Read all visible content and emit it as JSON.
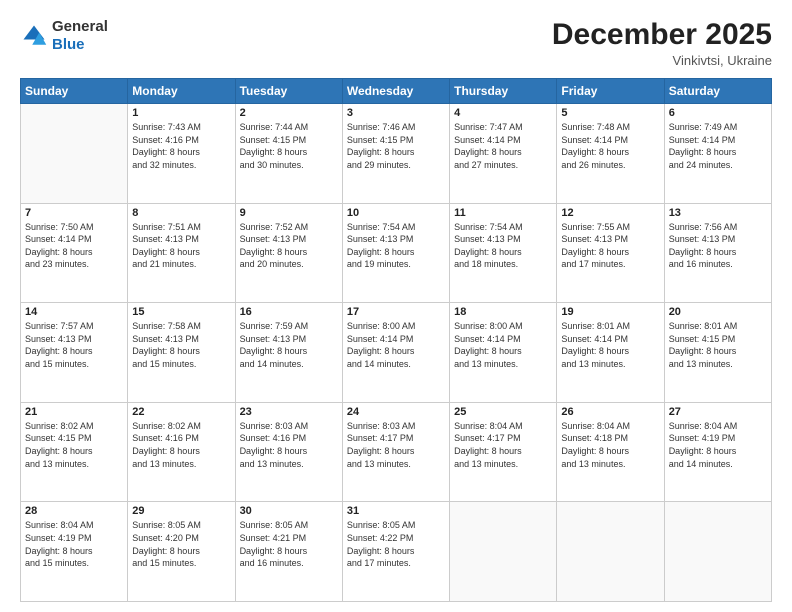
{
  "header": {
    "logo_general": "General",
    "logo_blue": "Blue",
    "month_title": "December 2025",
    "subtitle": "Vinkivtsi, Ukraine"
  },
  "days_of_week": [
    "Sunday",
    "Monday",
    "Tuesday",
    "Wednesday",
    "Thursday",
    "Friday",
    "Saturday"
  ],
  "weeks": [
    [
      {
        "day": "",
        "info": ""
      },
      {
        "day": "1",
        "info": "Sunrise: 7:43 AM\nSunset: 4:16 PM\nDaylight: 8 hours\nand 32 minutes."
      },
      {
        "day": "2",
        "info": "Sunrise: 7:44 AM\nSunset: 4:15 PM\nDaylight: 8 hours\nand 30 minutes."
      },
      {
        "day": "3",
        "info": "Sunrise: 7:46 AM\nSunset: 4:15 PM\nDaylight: 8 hours\nand 29 minutes."
      },
      {
        "day": "4",
        "info": "Sunrise: 7:47 AM\nSunset: 4:14 PM\nDaylight: 8 hours\nand 27 minutes."
      },
      {
        "day": "5",
        "info": "Sunrise: 7:48 AM\nSunset: 4:14 PM\nDaylight: 8 hours\nand 26 minutes."
      },
      {
        "day": "6",
        "info": "Sunrise: 7:49 AM\nSunset: 4:14 PM\nDaylight: 8 hours\nand 24 minutes."
      }
    ],
    [
      {
        "day": "7",
        "info": "Sunrise: 7:50 AM\nSunset: 4:14 PM\nDaylight: 8 hours\nand 23 minutes."
      },
      {
        "day": "8",
        "info": "Sunrise: 7:51 AM\nSunset: 4:13 PM\nDaylight: 8 hours\nand 21 minutes."
      },
      {
        "day": "9",
        "info": "Sunrise: 7:52 AM\nSunset: 4:13 PM\nDaylight: 8 hours\nand 20 minutes."
      },
      {
        "day": "10",
        "info": "Sunrise: 7:54 AM\nSunset: 4:13 PM\nDaylight: 8 hours\nand 19 minutes."
      },
      {
        "day": "11",
        "info": "Sunrise: 7:54 AM\nSunset: 4:13 PM\nDaylight: 8 hours\nand 18 minutes."
      },
      {
        "day": "12",
        "info": "Sunrise: 7:55 AM\nSunset: 4:13 PM\nDaylight: 8 hours\nand 17 minutes."
      },
      {
        "day": "13",
        "info": "Sunrise: 7:56 AM\nSunset: 4:13 PM\nDaylight: 8 hours\nand 16 minutes."
      }
    ],
    [
      {
        "day": "14",
        "info": "Sunrise: 7:57 AM\nSunset: 4:13 PM\nDaylight: 8 hours\nand 15 minutes."
      },
      {
        "day": "15",
        "info": "Sunrise: 7:58 AM\nSunset: 4:13 PM\nDaylight: 8 hours\nand 15 minutes."
      },
      {
        "day": "16",
        "info": "Sunrise: 7:59 AM\nSunset: 4:13 PM\nDaylight: 8 hours\nand 14 minutes."
      },
      {
        "day": "17",
        "info": "Sunrise: 8:00 AM\nSunset: 4:14 PM\nDaylight: 8 hours\nand 14 minutes."
      },
      {
        "day": "18",
        "info": "Sunrise: 8:00 AM\nSunset: 4:14 PM\nDaylight: 8 hours\nand 13 minutes."
      },
      {
        "day": "19",
        "info": "Sunrise: 8:01 AM\nSunset: 4:14 PM\nDaylight: 8 hours\nand 13 minutes."
      },
      {
        "day": "20",
        "info": "Sunrise: 8:01 AM\nSunset: 4:15 PM\nDaylight: 8 hours\nand 13 minutes."
      }
    ],
    [
      {
        "day": "21",
        "info": "Sunrise: 8:02 AM\nSunset: 4:15 PM\nDaylight: 8 hours\nand 13 minutes."
      },
      {
        "day": "22",
        "info": "Sunrise: 8:02 AM\nSunset: 4:16 PM\nDaylight: 8 hours\nand 13 minutes."
      },
      {
        "day": "23",
        "info": "Sunrise: 8:03 AM\nSunset: 4:16 PM\nDaylight: 8 hours\nand 13 minutes."
      },
      {
        "day": "24",
        "info": "Sunrise: 8:03 AM\nSunset: 4:17 PM\nDaylight: 8 hours\nand 13 minutes."
      },
      {
        "day": "25",
        "info": "Sunrise: 8:04 AM\nSunset: 4:17 PM\nDaylight: 8 hours\nand 13 minutes."
      },
      {
        "day": "26",
        "info": "Sunrise: 8:04 AM\nSunset: 4:18 PM\nDaylight: 8 hours\nand 13 minutes."
      },
      {
        "day": "27",
        "info": "Sunrise: 8:04 AM\nSunset: 4:19 PM\nDaylight: 8 hours\nand 14 minutes."
      }
    ],
    [
      {
        "day": "28",
        "info": "Sunrise: 8:04 AM\nSunset: 4:19 PM\nDaylight: 8 hours\nand 15 minutes."
      },
      {
        "day": "29",
        "info": "Sunrise: 8:05 AM\nSunset: 4:20 PM\nDaylight: 8 hours\nand 15 minutes."
      },
      {
        "day": "30",
        "info": "Sunrise: 8:05 AM\nSunset: 4:21 PM\nDaylight: 8 hours\nand 16 minutes."
      },
      {
        "day": "31",
        "info": "Sunrise: 8:05 AM\nSunset: 4:22 PM\nDaylight: 8 hours\nand 17 minutes."
      },
      {
        "day": "",
        "info": ""
      },
      {
        "day": "",
        "info": ""
      },
      {
        "day": "",
        "info": ""
      }
    ]
  ]
}
